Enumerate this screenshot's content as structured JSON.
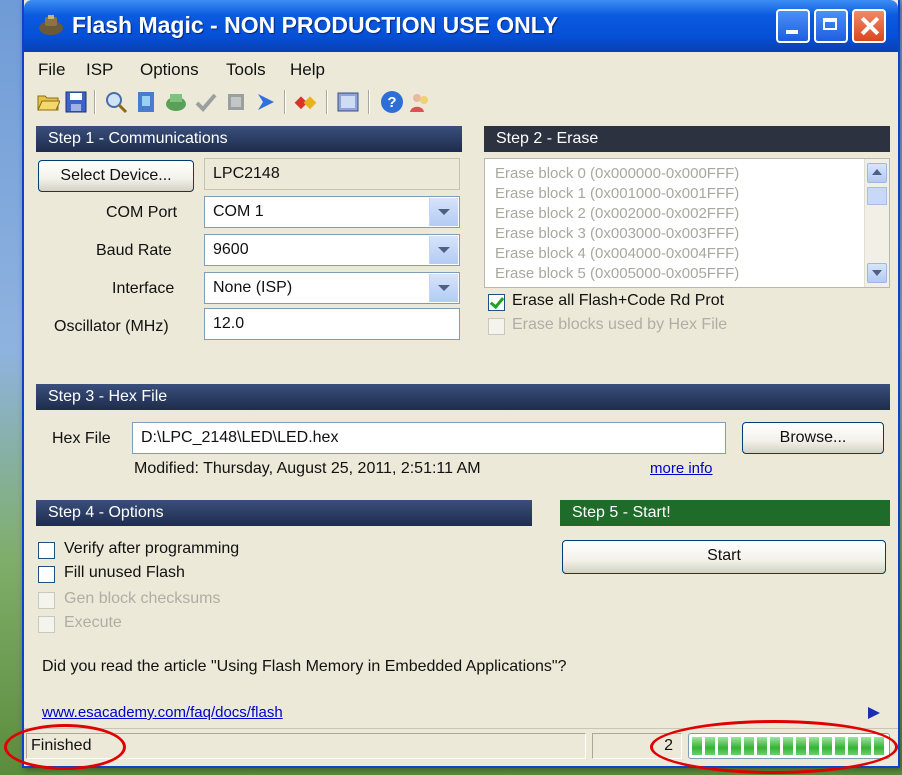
{
  "window": {
    "title": "Flash Magic - NON PRODUCTION USE ONLY"
  },
  "menu": [
    "File",
    "ISP",
    "Options",
    "Tools",
    "Help"
  ],
  "toolbar_icons": [
    "open-icon",
    "save-icon",
    "search-icon",
    "blank-check-icon",
    "program-icon",
    "verify-icon",
    "erase-icon",
    "go-icon",
    "chip-icon",
    "terminal-icon",
    "help-icon",
    "users-icon"
  ],
  "step1": {
    "header": "Step 1 - Communications",
    "select_device_label": "Select Device...",
    "device_value": "LPC2148",
    "com_port_label": "COM Port",
    "com_port_value": "COM 1",
    "baud_rate_label": "Baud Rate",
    "baud_rate_value": "9600",
    "interface_label": "Interface",
    "interface_value": "None (ISP)",
    "oscillator_label": "Oscillator (MHz)",
    "oscillator_value": "12.0"
  },
  "step2": {
    "header": "Step 2 - Erase",
    "blocks": [
      "Erase block 0 (0x000000-0x000FFF)",
      "Erase block 1 (0x001000-0x001FFF)",
      "Erase block 2 (0x002000-0x002FFF)",
      "Erase block 3 (0x003000-0x003FFF)",
      "Erase block 4 (0x004000-0x004FFF)",
      "Erase block 5 (0x005000-0x005FFF)"
    ],
    "erase_all_label": "Erase all Flash+Code Rd Prot",
    "erase_all_checked": true,
    "erase_used_label": "Erase blocks used by Hex File",
    "erase_used_checked": false
  },
  "step3": {
    "header": "Step 3 - Hex File",
    "hex_file_label": "Hex File",
    "hex_file_value": "D:\\LPC_2148\\LED\\LED.hex",
    "browse_label": "Browse...",
    "modified_text": "Modified: Thursday, August 25, 2011, 2:51:11 AM",
    "more_info_label": "more info"
  },
  "step4": {
    "header": "Step 4 - Options",
    "options": [
      {
        "label": "Verify after programming",
        "checked": false,
        "enabled": true
      },
      {
        "label": "Fill unused Flash",
        "checked": false,
        "enabled": true
      },
      {
        "label": "Gen block checksums",
        "checked": false,
        "enabled": false
      },
      {
        "label": "Execute",
        "checked": false,
        "enabled": false
      }
    ]
  },
  "step5": {
    "header": "Step 5 - Start!",
    "start_label": "Start"
  },
  "article": {
    "text": "Did you read the article \"Using Flash Memory in Embedded Applications\"?",
    "link": "www.esacademy.com/faq/docs/flash"
  },
  "status": {
    "text": "Finished",
    "count": "2",
    "progress": 1.0
  },
  "colors": {
    "title_bar": "#0550d6",
    "step_header": "#2d3240",
    "start_header": "#1f6b2a",
    "progress_fill": "#36b336",
    "annotation": "#e00000"
  }
}
